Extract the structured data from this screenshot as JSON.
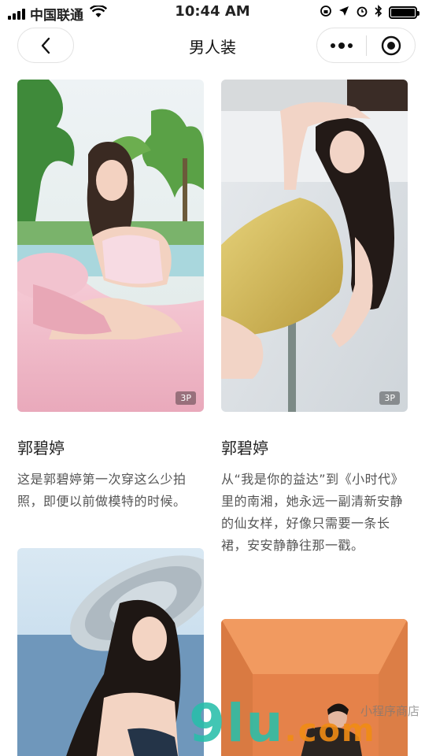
{
  "status_bar": {
    "carrier": "中国联通",
    "time": "10:44 AM"
  },
  "nav": {
    "title": "男人装"
  },
  "cards": [
    {
      "title": "郭碧婷",
      "description": "这是郭碧婷第一次穿这么少拍照，即便以前做模特的时候。",
      "photo_count": "3P"
    },
    {
      "title": "郭碧婷",
      "description": "从“我是你的益达”到《小时代》里的南湘，她永远一副清新安静的仙女样，好像只需要一条长裙，安安静静往那一戳。",
      "photo_count": "3P"
    }
  ],
  "watermark": {
    "main": "9lu",
    "tail": ".com",
    "small": "小程序商店"
  },
  "colors": {
    "background": "#ffffff",
    "border": "#e3e3e3"
  }
}
